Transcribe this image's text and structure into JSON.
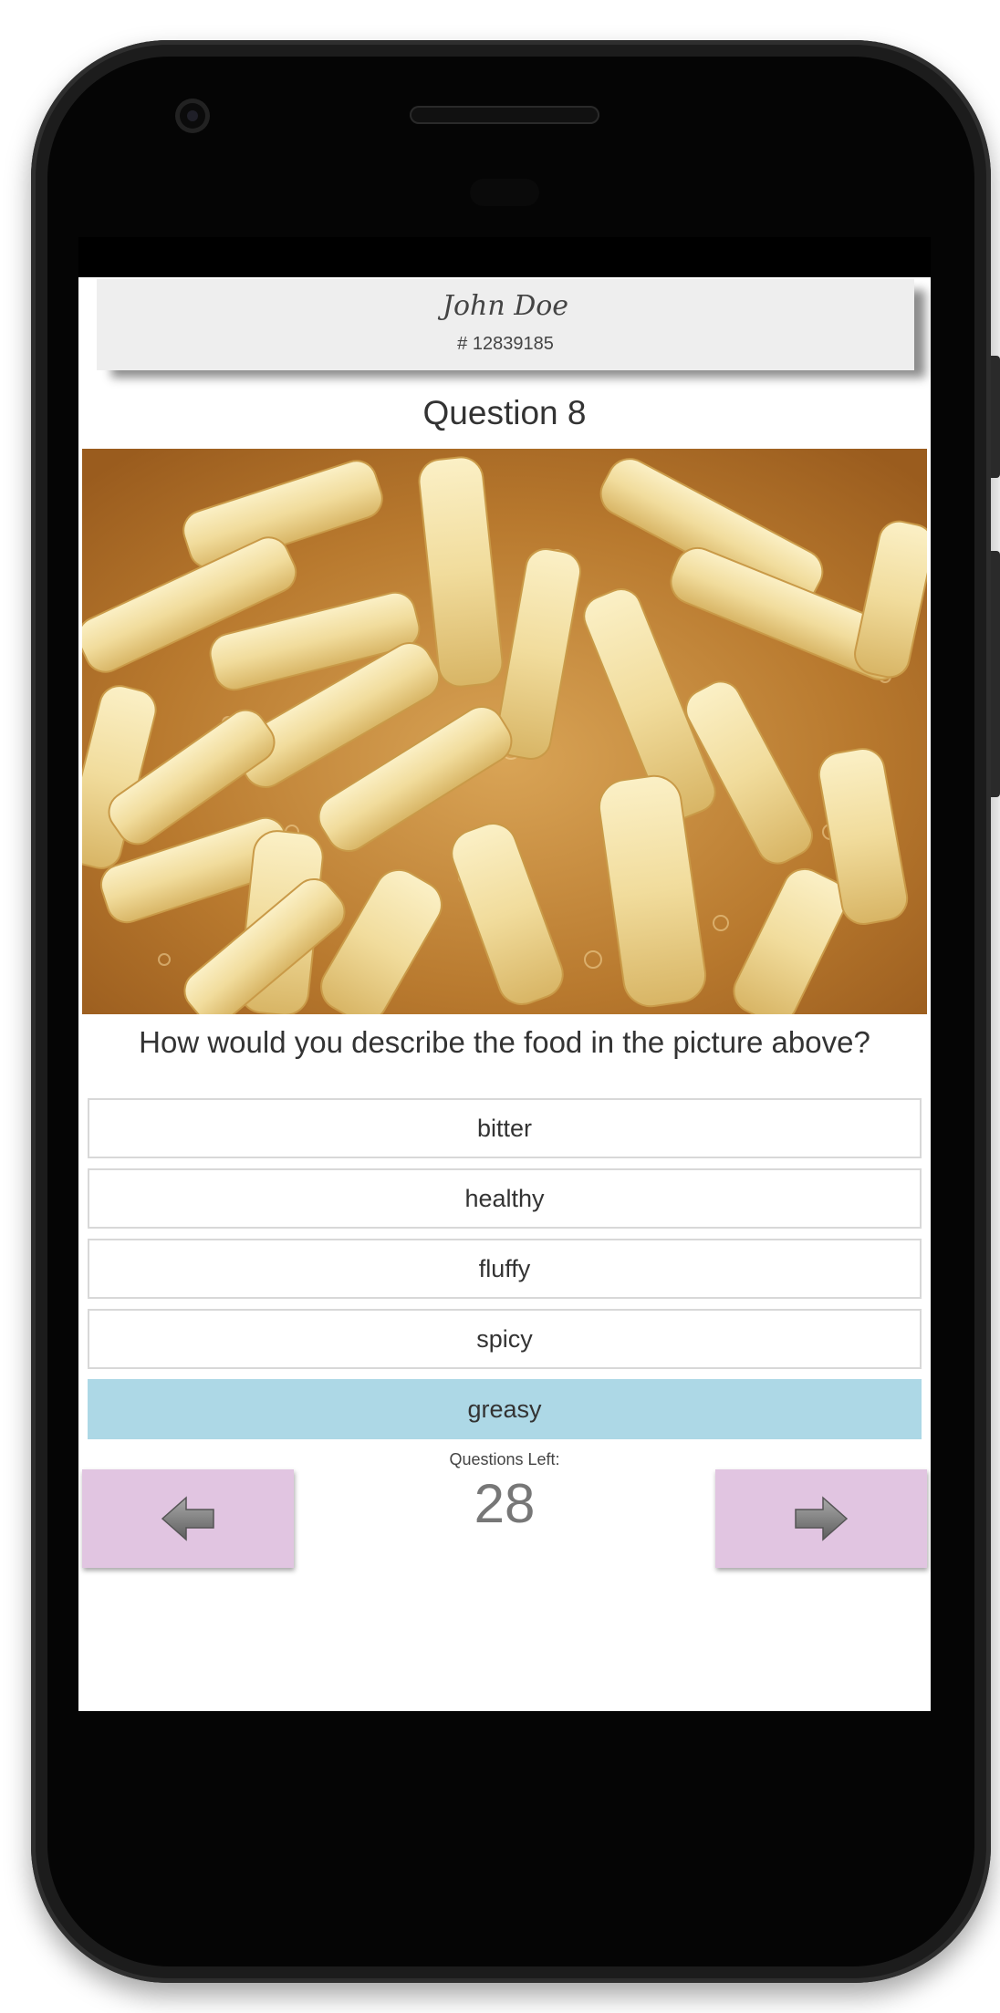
{
  "user": {
    "name": "John Doe",
    "id": "# 12839185"
  },
  "question": {
    "title": "Question 8",
    "image_alt": "food-photo",
    "text": "How would you describe the food in the picture above?"
  },
  "options": [
    {
      "label": "bitter",
      "selected": false
    },
    {
      "label": "healthy",
      "selected": false
    },
    {
      "label": "fluffy",
      "selected": false
    },
    {
      "label": "spicy",
      "selected": false
    },
    {
      "label": "greasy",
      "selected": true
    }
  ],
  "progress": {
    "label": "Questions Left:",
    "count": "28"
  },
  "navigation": {
    "prev_icon": "arrow-left-icon",
    "next_icon": "arrow-right-icon"
  },
  "colors": {
    "selected_option": "#add8e6",
    "nav_button": "#e1c5e1",
    "card": "#eeeeee"
  }
}
